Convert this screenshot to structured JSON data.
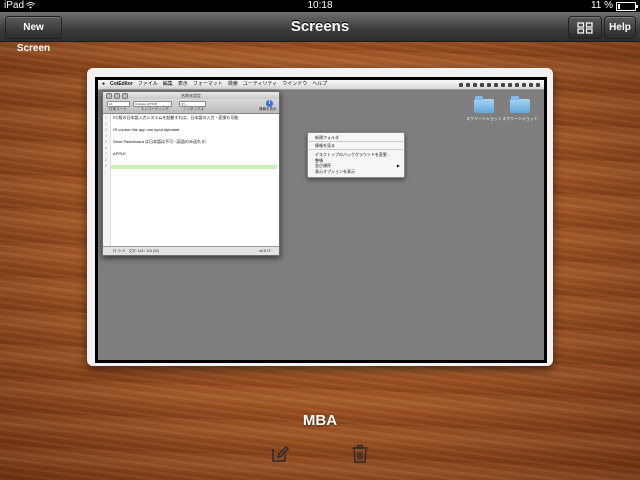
{
  "status_bar": {
    "device": "iPad",
    "time": "10:18",
    "battery_text": "11 %",
    "battery_level_percent": 11
  },
  "nav_bar": {
    "title": "Screens",
    "new_screen_label": "New Screen",
    "help_label": "Help",
    "grid_icon": "grid-icon"
  },
  "remote_screen": {
    "menubar": {
      "app": "CotEditor",
      "items": [
        "ファイル",
        "編集",
        "表示",
        "フォーマット",
        "検索",
        "ユーティリティ",
        "ウインドウ",
        "ヘルプ"
      ]
    },
    "desktop_folders": [
      {
        "label": "スクリーンショット"
      },
      {
        "label": "スクリーンショット"
      }
    ],
    "editor": {
      "title": "名称未設定",
      "toolbar": {
        "selects": [
          "LF",
          "Unicode (UTF-8)",
          "なし"
        ],
        "labels": [
          "行末コード",
          "エンコーディング",
          "シンタックス",
          "情報を表示"
        ]
      },
      "lines": [
        "PC版の日本語入力システムを起動すれば、日本語の入力・変換も可能",
        "",
        "Of course this app can input alphabet.",
        "",
        "Send Pasteboard は日本語は不可（英語のみ送れる）",
        "",
        "APPLE",
        "",
        ""
      ],
      "line_numbers": [
        "1",
        "2",
        "3",
        "4",
        "5",
        "6",
        "7",
        "8",
        "9"
      ],
      "footer_left": "行: 9 / 9　文字: 118 / 118 (34)",
      "footer_right": "utf-8 LF"
    },
    "context_menu": {
      "items": [
        "新規フォルダ",
        "情報を見る",
        "デスクトップのバックグラウンドを変更...",
        "整頓",
        "並び順序",
        "表示オプションを表示"
      ]
    }
  },
  "screen_label": "MBA",
  "actions": {
    "edit_icon": "edit-icon",
    "delete_icon": "trash-icon"
  },
  "colors": {
    "wood": "#9b5022",
    "nav_bar": "#3b3b3b",
    "editor_highlight": "#c9f0b6",
    "folder": "#62a8dd"
  }
}
